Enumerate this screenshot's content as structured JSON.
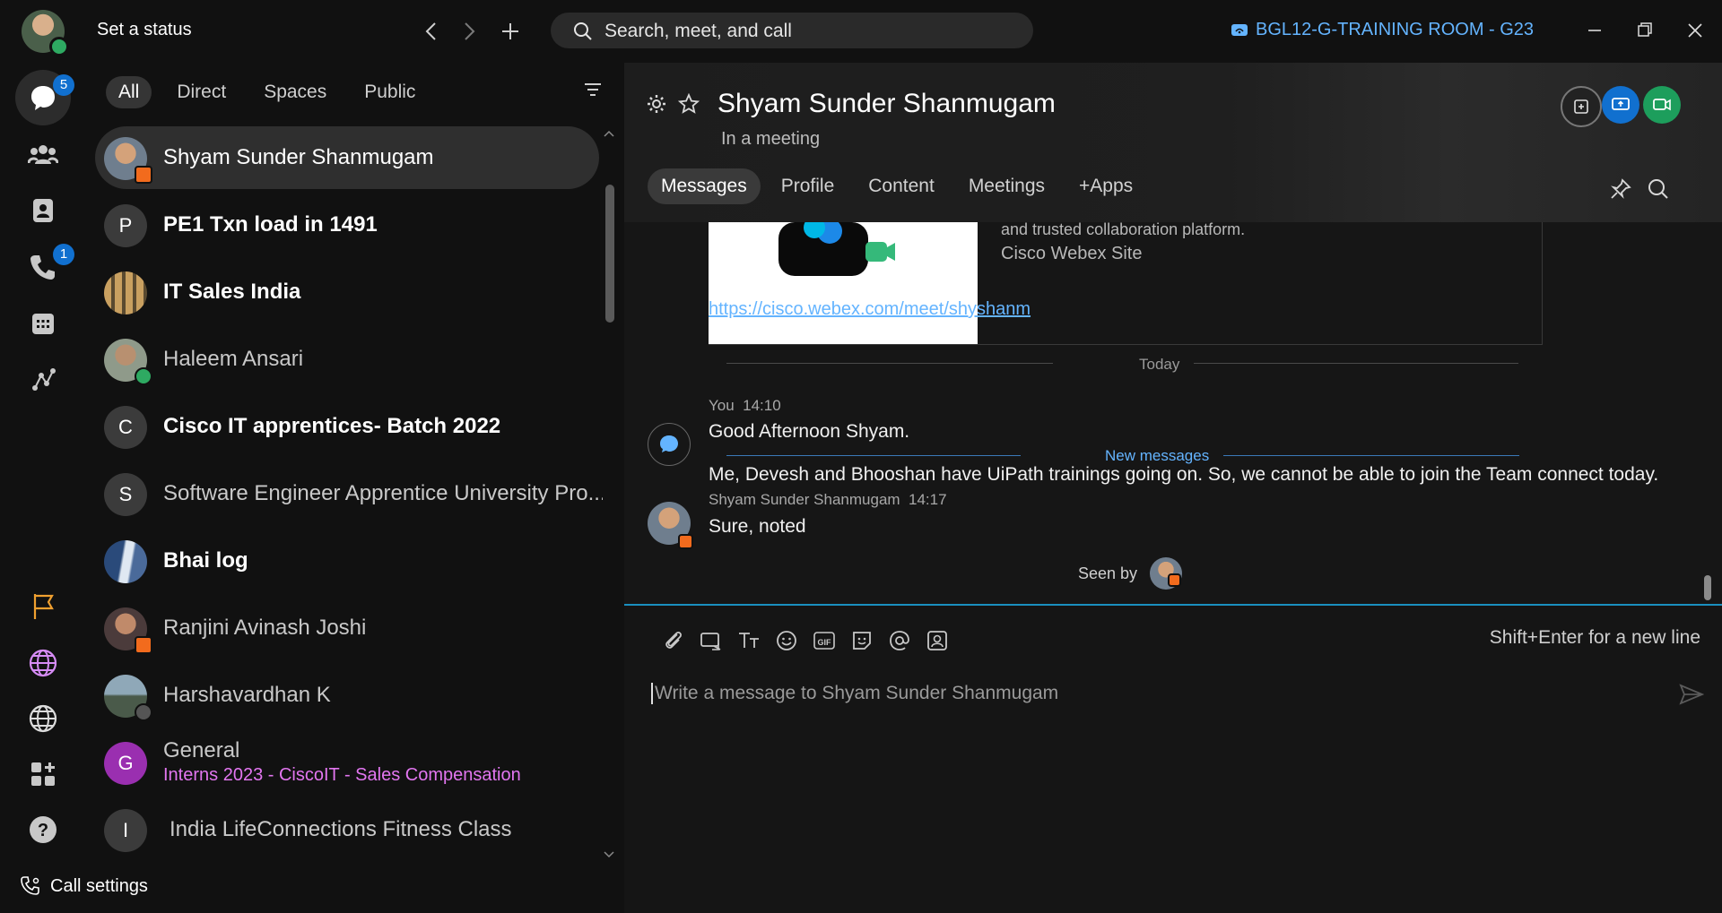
{
  "titlebar": {
    "status_label": "Set a status",
    "search_placeholder": "Search, meet, and call",
    "device_name": "BGL12-G-TRAINING ROOM - G23"
  },
  "rail": {
    "messaging_badge": "5",
    "calling_badge": "1",
    "call_settings_label": "Call settings"
  },
  "filters": [
    "All",
    "Direct",
    "Spaces",
    "Public"
  ],
  "conversations": [
    {
      "name": "Shyam Sunder Shanmugam",
      "initial": "",
      "bold": false
    },
    {
      "name": "PE1 Txn load in 1491",
      "initial": "P",
      "bold": true
    },
    {
      "name": "IT Sales India",
      "initial": "",
      "bold": true
    },
    {
      "name": "Haleem Ansari",
      "initial": "",
      "bold": false
    },
    {
      "name": "Cisco IT apprentices- Batch 2022",
      "initial": "C",
      "bold": true
    },
    {
      "name": "Software Engineer Apprentice University Pro...",
      "initial": "S",
      "bold": false
    },
    {
      "name": "Bhai log",
      "initial": "",
      "bold": true
    },
    {
      "name": "Ranjini Avinash Joshi",
      "initial": "",
      "bold": false
    },
    {
      "name": "Harshavardhan K",
      "initial": "",
      "bold": false
    },
    {
      "name": "General",
      "initial": "G",
      "bold": false,
      "subtitle": "Interns 2023 - CiscoIT - Sales Compensation"
    },
    {
      "name": "India LifeConnections Fitness Class",
      "initial": "I",
      "bold": false
    }
  ],
  "chat": {
    "title": "Shyam Sunder Shanmugam",
    "status": "In a meeting",
    "tabs": [
      "Messages",
      "Profile",
      "Content",
      "Meetings",
      "+Apps"
    ],
    "card_description": "and trusted collaboration platform.",
    "card_site": "Cisco Webex Site",
    "link": "https://cisco.webex.com/meet/shyshanm",
    "today_label": "Today",
    "messages": [
      {
        "sender": "You",
        "time": "14:10",
        "lines": [
          "Good Afternoon Shyam.",
          "Me, Devesh and Bhooshan have UiPath trainings going on. So, we cannot be able to join the Team connect today."
        ]
      },
      {
        "sender": "Shyam Sunder Shanmugam",
        "time": "14:17",
        "lines": [
          "Sure, noted"
        ]
      }
    ],
    "new_messages_label": "New messages",
    "seen_by_label": "Seen by"
  },
  "composer": {
    "hint": "Shift+Enter for a new line",
    "placeholder": "Write a message to Shyam Sunder Shanmugam"
  },
  "colors": {
    "accent_blue": "#64b4ff",
    "badge_blue": "#1170cf",
    "presence_green": "#2eaa62",
    "meeting_orange": "#f26b1d",
    "space_subtitle": "#e276f0"
  }
}
